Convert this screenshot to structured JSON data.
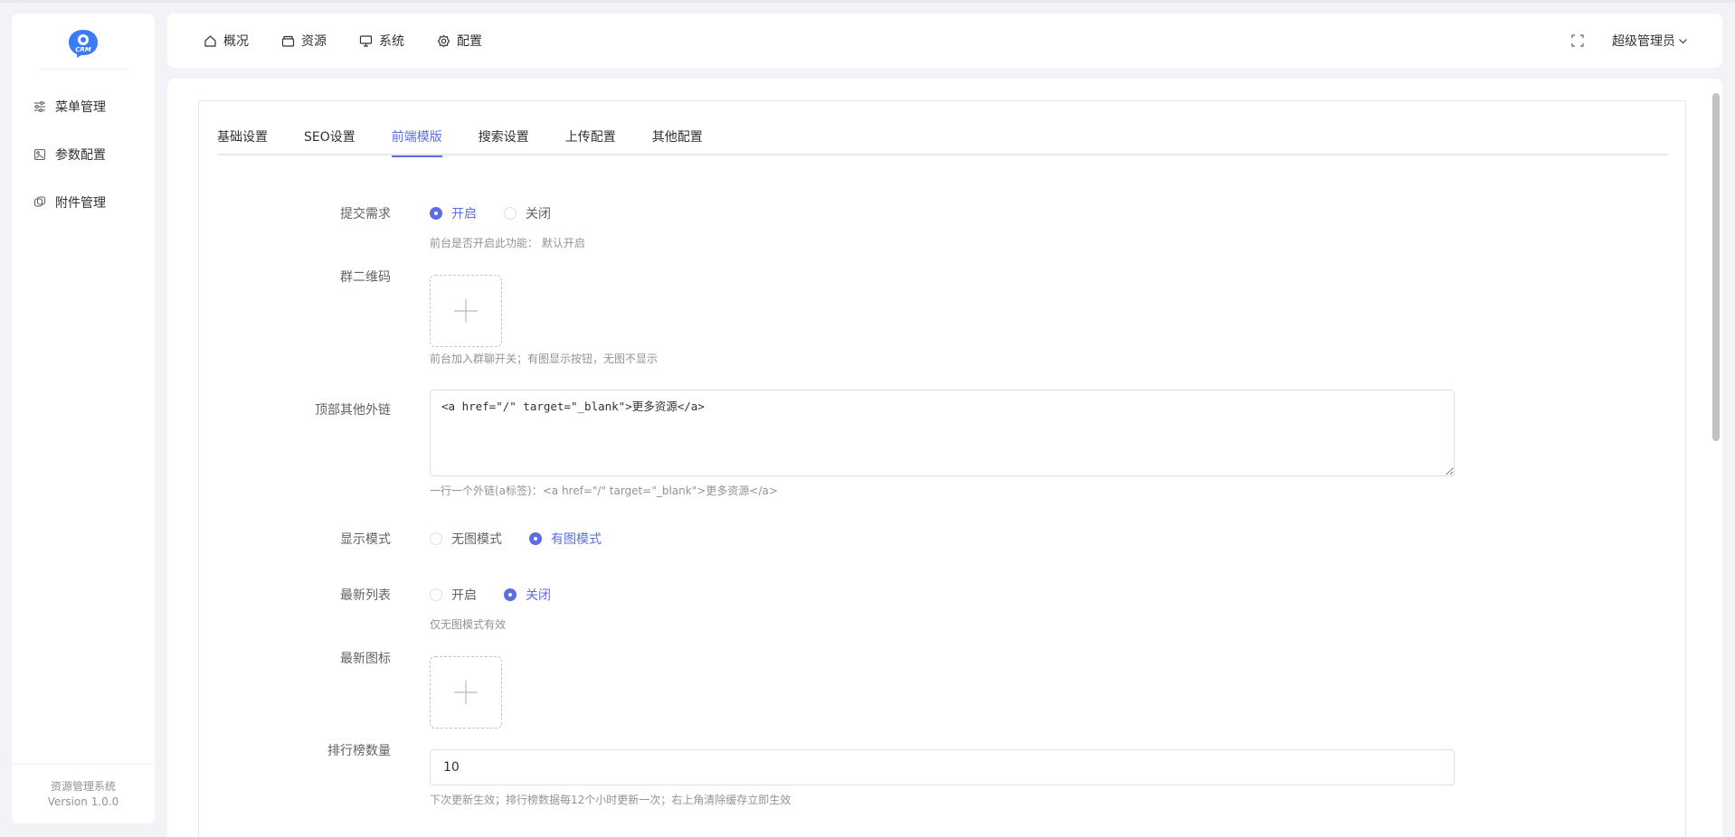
{
  "sidebar": {
    "logo_alt": "CRM",
    "items": [
      {
        "label": "菜单管理",
        "icon": "sliders-icon"
      },
      {
        "label": "参数配置",
        "icon": "image-config-icon"
      },
      {
        "label": "附件管理",
        "icon": "attachment-icon"
      }
    ],
    "footer_title": "资源管理系统",
    "footer_version": "Version 1.0.0"
  },
  "header": {
    "nav": [
      {
        "label": "概况",
        "icon": "home-icon"
      },
      {
        "label": "资源",
        "icon": "box-icon"
      },
      {
        "label": "系统",
        "icon": "monitor-icon"
      },
      {
        "label": "配置",
        "icon": "gear-icon"
      }
    ],
    "user_label": "超级管理员"
  },
  "tabs": [
    "基础设置",
    "SEO设置",
    "前端模版",
    "搜索设置",
    "上传配置",
    "其他配置"
  ],
  "active_tab": 2,
  "form": {
    "submit_demand": {
      "label": "提交需求",
      "options": [
        "开启",
        "关闭"
      ],
      "selected": 0,
      "hint": "前台是否开启此功能：  默认开启"
    },
    "group_qr": {
      "label": "群二维码",
      "hint": "前台加入群聊开关；有图显示按钮，无图不显示"
    },
    "top_links": {
      "label": "顶部其他外链",
      "value": "<a href=\"/\" target=\"_blank\">更多资源</a>",
      "hint": "一行一个外链(a标签)：<a href=\"/\" target=\"_blank\">更多资源</a>"
    },
    "display_mode": {
      "label": "显示模式",
      "options": [
        "无图模式",
        "有图模式"
      ],
      "selected": 1
    },
    "latest_list": {
      "label": "最新列表",
      "options": [
        "开启",
        "关闭"
      ],
      "selected": 1,
      "hint": "仅无图模式有效"
    },
    "latest_icon": {
      "label": "最新图标"
    },
    "rank_count": {
      "label": "排行榜数量",
      "value": "10",
      "hint": "下次更新生效；排行榜数据每12个小时更新一次；右上角清除缓存立即生效"
    }
  },
  "colors": {
    "accent": "#5b6ee1",
    "brand": "#3a7bf7"
  }
}
